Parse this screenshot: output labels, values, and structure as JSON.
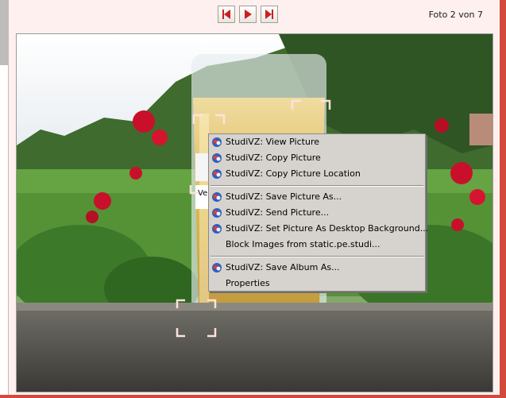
{
  "counter": "Foto 2 von 7",
  "photo": {
    "tooltip_fragment": "Ve"
  },
  "context_menu": {
    "groups": [
      [
        "StudiVZ: View Picture",
        "StudiVZ: Copy Picture",
        "StudiVZ: Copy Picture Location"
      ],
      [
        "StudiVZ: Save Picture As...",
        "StudiVZ: Send Picture...",
        "StudiVZ: Set Picture As Desktop Background...",
        "Block Images from static.pe.studi..."
      ],
      [
        "StudiVZ: Save Album As...",
        "Properties"
      ]
    ]
  },
  "colors": {
    "accent": "#d24a3c",
    "background": "#fdf0ee",
    "menu_bg": "#d6d3ce"
  },
  "icons": {
    "first": "skip-first-icon",
    "play": "play-icon",
    "last": "skip-last-icon",
    "menu": "studivz-icon"
  }
}
